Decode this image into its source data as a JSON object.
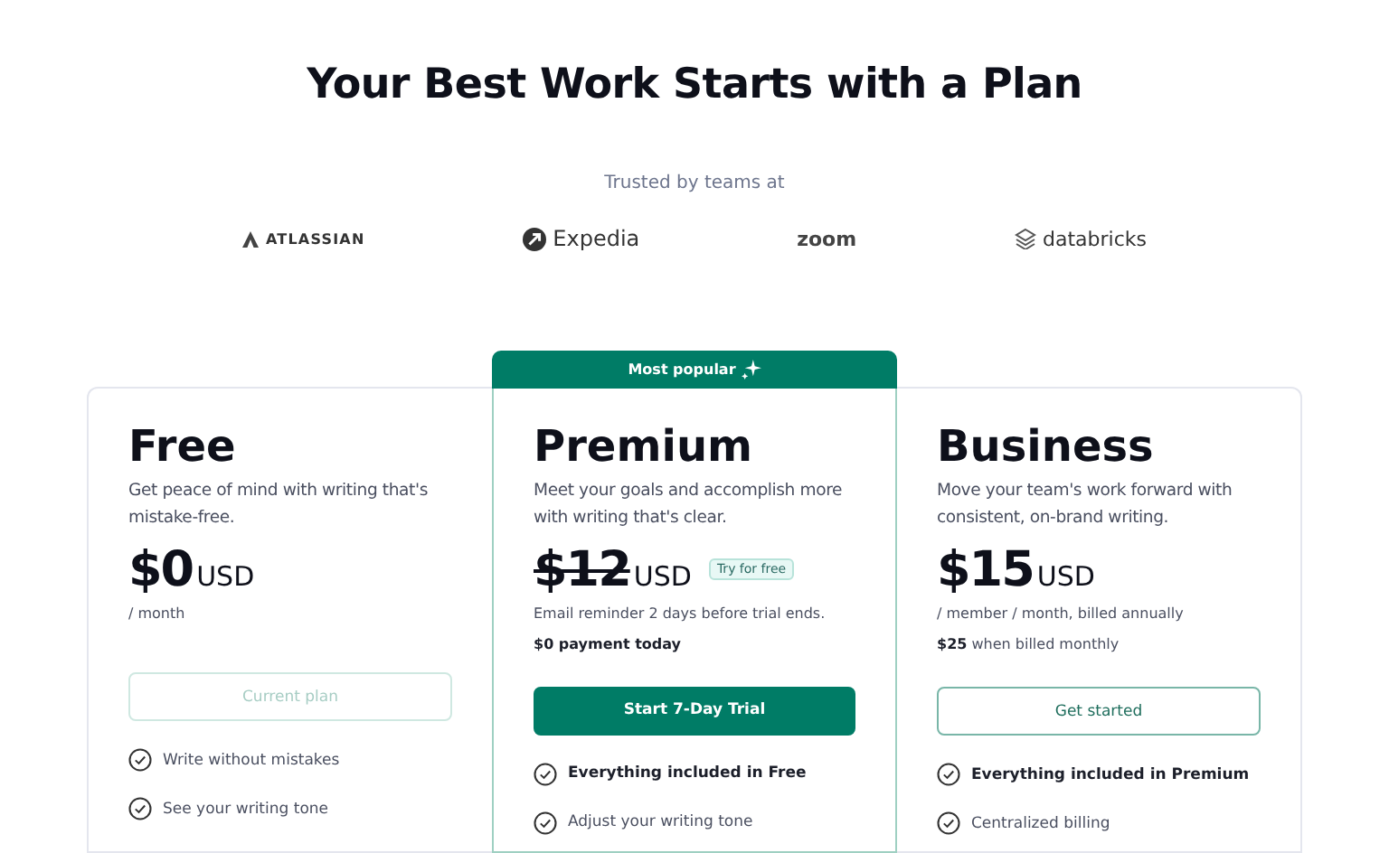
{
  "heading": "Your Best Work Starts with a Plan",
  "trusted": {
    "label": "Trusted by teams at",
    "logos": [
      {
        "kind": "atlassian",
        "name": "ATLASSIAN"
      },
      {
        "kind": "expedia",
        "name": "Expedia"
      },
      {
        "kind": "zoom",
        "name": "zoom"
      },
      {
        "kind": "databricks",
        "name": "databricks"
      }
    ]
  },
  "plans": [
    {
      "name": "Free",
      "featured": false,
      "description": "Get peace of mind with writing that's mistake-free.",
      "price": "$0",
      "currency": "USD",
      "struck": false,
      "period": "/ month",
      "button": {
        "label": "Current plan",
        "kind": "disabled"
      },
      "features": [
        {
          "text": "Write without mistakes",
          "bold": false
        },
        {
          "text": "See your writing tone",
          "bold": false
        }
      ]
    },
    {
      "name": "Premium",
      "featured": true,
      "ribbon": "Most popular",
      "description": "Meet your goals and accomplish more with writing that's clear.",
      "price": "$12",
      "currency": "USD",
      "struck": true,
      "badge": "Try for free",
      "period": "Email reminder 2 days before trial ends.",
      "notes": [
        {
          "text": "$0 payment today",
          "bold": true
        }
      ],
      "button": {
        "label": "Start 7-Day Trial",
        "kind": "primary"
      },
      "features": [
        {
          "text": "Everything included in Free",
          "bold": true
        },
        {
          "text": "Adjust your writing tone",
          "bold": false
        }
      ]
    },
    {
      "name": "Business",
      "featured": false,
      "description": "Move your team's work forward with consistent, on-brand writing.",
      "price": "$15",
      "currency": "USD",
      "struck": false,
      "period": "/ member / month, billed annually",
      "notes": [
        {
          "text": "**$25** when billed monthly",
          "bold": false
        }
      ],
      "button": {
        "label": "Get started",
        "kind": "outline"
      },
      "features": [
        {
          "text": "Everything included in Premium",
          "bold": true
        },
        {
          "text": "Centralized billing",
          "bold": false
        }
      ]
    }
  ]
}
